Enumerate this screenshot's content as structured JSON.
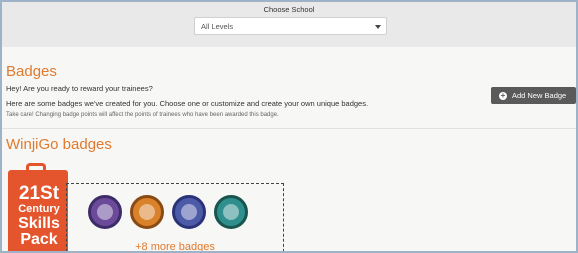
{
  "school": {
    "label": "Choose School",
    "selected": "All Levels"
  },
  "badges": {
    "title": "Badges",
    "intro": "Hey! Are you ready to reward your trainees?",
    "description": "Here are some badges we've created for you. Choose one or customize and create your own unique badges.",
    "warning": "Take care! Changing badge points will affect the points of trainees who have been awarded this badge.",
    "add_button": "Add New Badge"
  },
  "wjbadges": {
    "title": "WinjiGo badges",
    "pack": {
      "line1": "21St",
      "line2": "Century",
      "line3": "Skills",
      "line4": "Pack"
    },
    "badge_icons": [
      "astronaut-badge-icon",
      "people-badge-icon",
      "team-badge-icon",
      "globe-badge-icon"
    ],
    "more": "+8 more badges"
  },
  "colors": {
    "accent": "#e07a2e",
    "pack": "#e4552d",
    "button": "#5a5a5a"
  }
}
